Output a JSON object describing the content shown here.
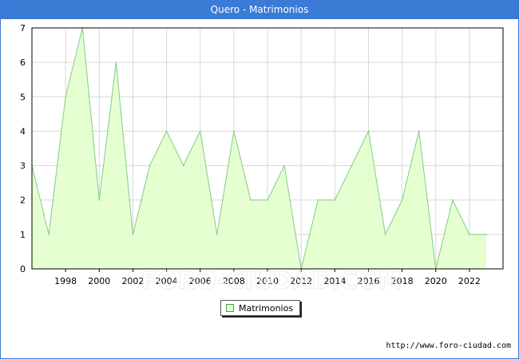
{
  "header": {
    "title": "Quero - Matrimonios"
  },
  "legend": {
    "label": "Matrimonios"
  },
  "source": {
    "text": "http://www.foro-ciudad.com"
  },
  "watermark": {
    "text": "FORO-CIUDAD.COM"
  },
  "colors": {
    "title_bg": "#3a7bd5",
    "area_fill": "#e2ffc8",
    "line": "#7fcc86",
    "grid": "#d8d8d8"
  },
  "chart_data": {
    "type": "area",
    "title": "Quero - Matrimonios",
    "xlabel": "",
    "ylabel": "",
    "x": [
      1996,
      1997,
      1998,
      1999,
      2000,
      2001,
      2002,
      2003,
      2004,
      2005,
      2006,
      2007,
      2008,
      2009,
      2010,
      2011,
      2012,
      2013,
      2014,
      2015,
      2016,
      2017,
      2018,
      2019,
      2020,
      2021,
      2022,
      2023
    ],
    "series": [
      {
        "name": "Matrimonios",
        "values": [
          3,
          1,
          5,
          7,
          2,
          6,
          1,
          3,
          4,
          3,
          4,
          1,
          4,
          2,
          2,
          3,
          0,
          2,
          2,
          3,
          4,
          1,
          2,
          4,
          0,
          2,
          1,
          1
        ]
      }
    ],
    "xticks": [
      "1998",
      "2000",
      "2002",
      "2004",
      "2006",
      "2008",
      "2010",
      "2012",
      "2014",
      "2016",
      "2018",
      "2020",
      "2022"
    ],
    "yticks": [
      "0",
      "1",
      "2",
      "3",
      "4",
      "5",
      "6",
      "7"
    ],
    "xlim": [
      1996,
      2023
    ],
    "ylim": [
      0,
      7
    ],
    "grid": true,
    "legend_position": "bottom-center"
  }
}
